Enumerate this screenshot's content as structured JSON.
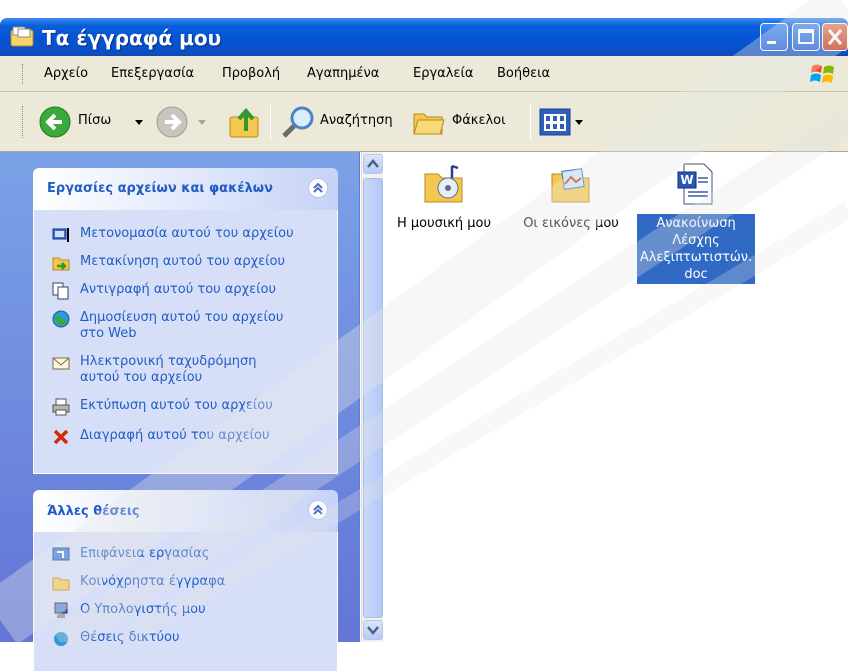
{
  "window": {
    "title": "Τα έγγραφά μου"
  },
  "menubar": {
    "items": [
      "Αρχείο",
      "Επεξεργασία",
      "Προβολή",
      "Αγαπημένα",
      "Εργαλεία",
      "Βοήθεια"
    ]
  },
  "toolbar": {
    "back": "Πίσω",
    "search": "Αναζήτηση",
    "folders": "Φάκελοι"
  },
  "taskpane": {
    "file_tasks": {
      "title": "Εργασίες αρχείων και φακέλων",
      "items": [
        {
          "label": "Μετονομασία αυτού του αρχείου",
          "icon": "rename-icon"
        },
        {
          "label": "Μετακίνηση αυτού του αρχείου",
          "icon": "move-icon"
        },
        {
          "label": "Αντιγραφή αυτού του αρχείου",
          "icon": "copy-icon"
        },
        {
          "label": "Δημοσίευση αυτού του αρχείου",
          "label2": "στο Web",
          "icon": "publish-web-icon"
        },
        {
          "label": "Ηλεκτρονική ταχυδρόμηση",
          "label2": "αυτού του αρχείου",
          "icon": "email-icon"
        },
        {
          "label": "Εκτύπωση αυτού του αρχείου",
          "icon": "print-icon"
        },
        {
          "label": "Διαγραφή αυτού του αρχείου",
          "icon": "delete-icon"
        }
      ]
    },
    "other_places": {
      "title": "Άλλες θέσεις",
      "items": [
        {
          "label": "Επιφάνεια εργασίας",
          "icon": "desktop-icon"
        },
        {
          "label": "Κοινόχρηστα έγγραφα",
          "icon": "shared-folder-icon"
        },
        {
          "label": "Ο Υπολογιστής μου",
          "icon": "my-computer-icon"
        },
        {
          "label": "Θέσεις δικτύου",
          "icon": "network-places-icon"
        }
      ]
    }
  },
  "files": [
    {
      "name": "Η μουσική μου",
      "icon": "music-folder-icon"
    },
    {
      "name": "Οι εικόνες μου",
      "icon": "pictures-folder-icon"
    },
    {
      "name_lines": [
        "Ανακοίνωση",
        "Λέσχης",
        "Αλεξιπτωτιστών.",
        "doc"
      ],
      "icon": "word-document-icon",
      "selected": true
    }
  ],
  "colors": {
    "titlebar": "#0553d3",
    "taskpane": "#6f8fdf",
    "link": "#215dc6",
    "selection": "#316ac5"
  }
}
